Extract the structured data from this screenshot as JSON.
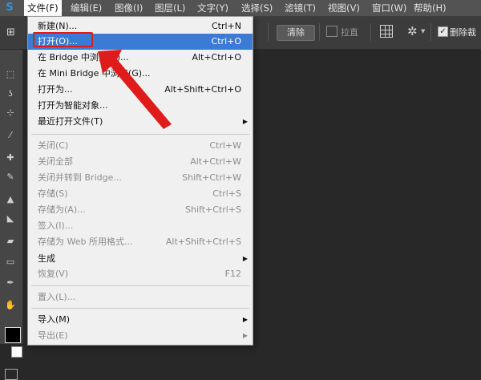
{
  "app": {
    "logo": "S"
  },
  "menubar": {
    "items": [
      "文件(F)",
      "编辑(E)",
      "图像(I)",
      "图层(L)",
      "文字(Y)",
      "选择(S)",
      "滤镜(T)",
      "视图(V)",
      "窗口(W)",
      "帮助(H)"
    ]
  },
  "options_bar": {
    "clear_label": "清除",
    "straighten_label": "拉直",
    "delete_crop_label": "删除裁"
  },
  "file_menu": {
    "items": [
      {
        "label": "新建(N)...",
        "shortcut": "Ctrl+N"
      },
      {
        "label": "打开(O)...",
        "shortcut": "Ctrl+O"
      },
      {
        "label": "在 Bridge 中浏览(B)...",
        "shortcut": "Alt+Ctrl+O"
      },
      {
        "label": "在 Mini Bridge 中浏览(G)...",
        "shortcut": ""
      },
      {
        "label": "打开为...",
        "shortcut": "Alt+Shift+Ctrl+O"
      },
      {
        "label": "打开为智能对象...",
        "shortcut": ""
      },
      {
        "label": "最近打开文件(T)",
        "shortcut": ""
      },
      {
        "label": "关闭(C)",
        "shortcut": "Ctrl+W"
      },
      {
        "label": "关闭全部",
        "shortcut": "Alt+Ctrl+W"
      },
      {
        "label": "关闭并转到 Bridge...",
        "shortcut": "Shift+Ctrl+W"
      },
      {
        "label": "存储(S)",
        "shortcut": "Ctrl+S"
      },
      {
        "label": "存储为(A)...",
        "shortcut": "Shift+Ctrl+S"
      },
      {
        "label": "签入(I)...",
        "shortcut": ""
      },
      {
        "label": "存储为 Web 所用格式...",
        "shortcut": "Alt+Shift+Ctrl+S"
      },
      {
        "label": "生成",
        "shortcut": ""
      },
      {
        "label": "恢复(V)",
        "shortcut": "F12"
      },
      {
        "label": "置入(L)...",
        "shortcut": ""
      },
      {
        "label": "导入(M)",
        "shortcut": ""
      },
      {
        "label": "导出(E)",
        "shortcut": ""
      }
    ]
  },
  "colors": {
    "highlight": "#3b7bd6",
    "annotation": "#e01b1b",
    "menubar": "#535353",
    "workspace": "#282828"
  }
}
